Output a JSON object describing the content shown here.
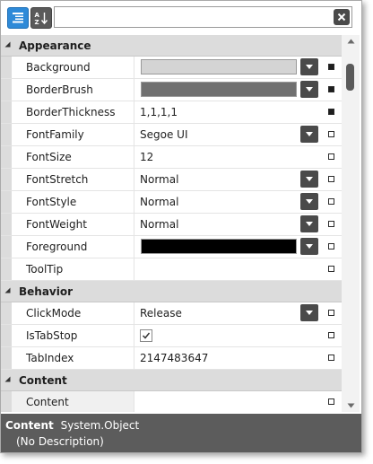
{
  "toolbar": {
    "categorized_icon": "categorized-list-icon",
    "alphabetical_icon": "sort-az-icon",
    "search_value": "",
    "search_placeholder": "",
    "clear_icon": "close-icon"
  },
  "colors": {
    "accent": "#2e8ad8",
    "button_dark": "#4a4a4a",
    "category_bg": "#dcdcdc",
    "description_bg": "#5c5c5c"
  },
  "categories": [
    {
      "name": "Appearance",
      "expanded": true,
      "properties": [
        {
          "name": "Background",
          "editor": "color",
          "value": "",
          "color": "#d4d4d4",
          "marker": "filled"
        },
        {
          "name": "BorderBrush",
          "editor": "color",
          "value": "",
          "color": "#707070",
          "marker": "filled"
        },
        {
          "name": "BorderThickness",
          "editor": "text",
          "value": "1,1,1,1",
          "marker": "filled"
        },
        {
          "name": "FontFamily",
          "editor": "dropdown",
          "value": "Segoe UI",
          "marker": "empty"
        },
        {
          "name": "FontSize",
          "editor": "text",
          "value": "12",
          "marker": "empty"
        },
        {
          "name": "FontStretch",
          "editor": "dropdown",
          "value": "Normal",
          "marker": "empty"
        },
        {
          "name": "FontStyle",
          "editor": "dropdown",
          "value": "Normal",
          "marker": "empty"
        },
        {
          "name": "FontWeight",
          "editor": "dropdown",
          "value": "Normal",
          "marker": "empty"
        },
        {
          "name": "Foreground",
          "editor": "color",
          "value": "",
          "color": "#000000",
          "marker": "empty"
        },
        {
          "name": "ToolTip",
          "editor": "text",
          "value": "",
          "marker": "empty"
        }
      ]
    },
    {
      "name": "Behavior",
      "expanded": true,
      "properties": [
        {
          "name": "ClickMode",
          "editor": "dropdown",
          "value": "Release",
          "marker": "empty"
        },
        {
          "name": "IsTabStop",
          "editor": "checkbox",
          "value": "",
          "checked": true,
          "marker": "empty"
        },
        {
          "name": "TabIndex",
          "editor": "text",
          "value": "2147483647",
          "marker": "empty"
        }
      ]
    },
    {
      "name": "Content",
      "expanded": true,
      "properties": [
        {
          "name": "Content",
          "editor": "text",
          "value": "",
          "marker": "empty",
          "selected": true
        }
      ]
    }
  ],
  "description": {
    "title": "Content",
    "type": "System.Object",
    "text": "(No Description)"
  }
}
